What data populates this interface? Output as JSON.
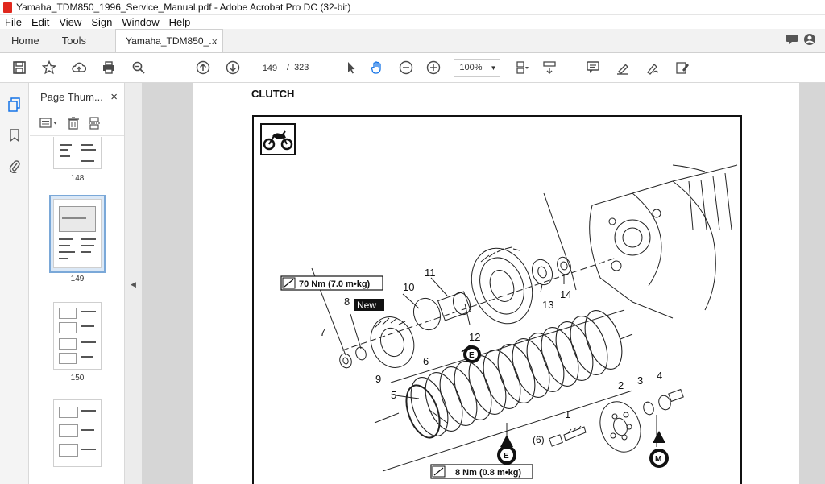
{
  "window": {
    "title": "Yamaha_TDM850_1996_Service_Manual.pdf - Adobe Acrobat Pro DC (32-bit)"
  },
  "menu": {
    "items": [
      "File",
      "Edit",
      "View",
      "Sign",
      "Window",
      "Help"
    ]
  },
  "tabs": {
    "home": "Home",
    "tools": "Tools",
    "document": "Yamaha_TDM850_...",
    "close": "×"
  },
  "toolbar": {
    "current_page": "149",
    "page_separator": "/",
    "total_pages": "323",
    "zoom": "100%"
  },
  "thumbnails": {
    "panel_title": "Page Thum...",
    "close": "×",
    "pages": [
      {
        "label": "148"
      },
      {
        "label": "149",
        "selected": true
      },
      {
        "label": "150"
      },
      {
        "label": ""
      }
    ]
  },
  "document": {
    "heading": "CLUTCH",
    "callouts": [
      "1",
      "2",
      "3",
      "4",
      "5",
      "6",
      "7",
      "8",
      "9",
      "10",
      "11",
      "12",
      "13",
      "14",
      "(6)"
    ],
    "new_badge": "New",
    "torque_top": "70 Nm (7.0 m•kg)",
    "torque_bottom": "8 Nm (0.8 m•kg)",
    "lube_e": "E",
    "lube_m": "M"
  },
  "colors": {
    "accent": "#1473e6",
    "selection": "#dbe8f6",
    "pdf_icon": "#e0281e"
  }
}
